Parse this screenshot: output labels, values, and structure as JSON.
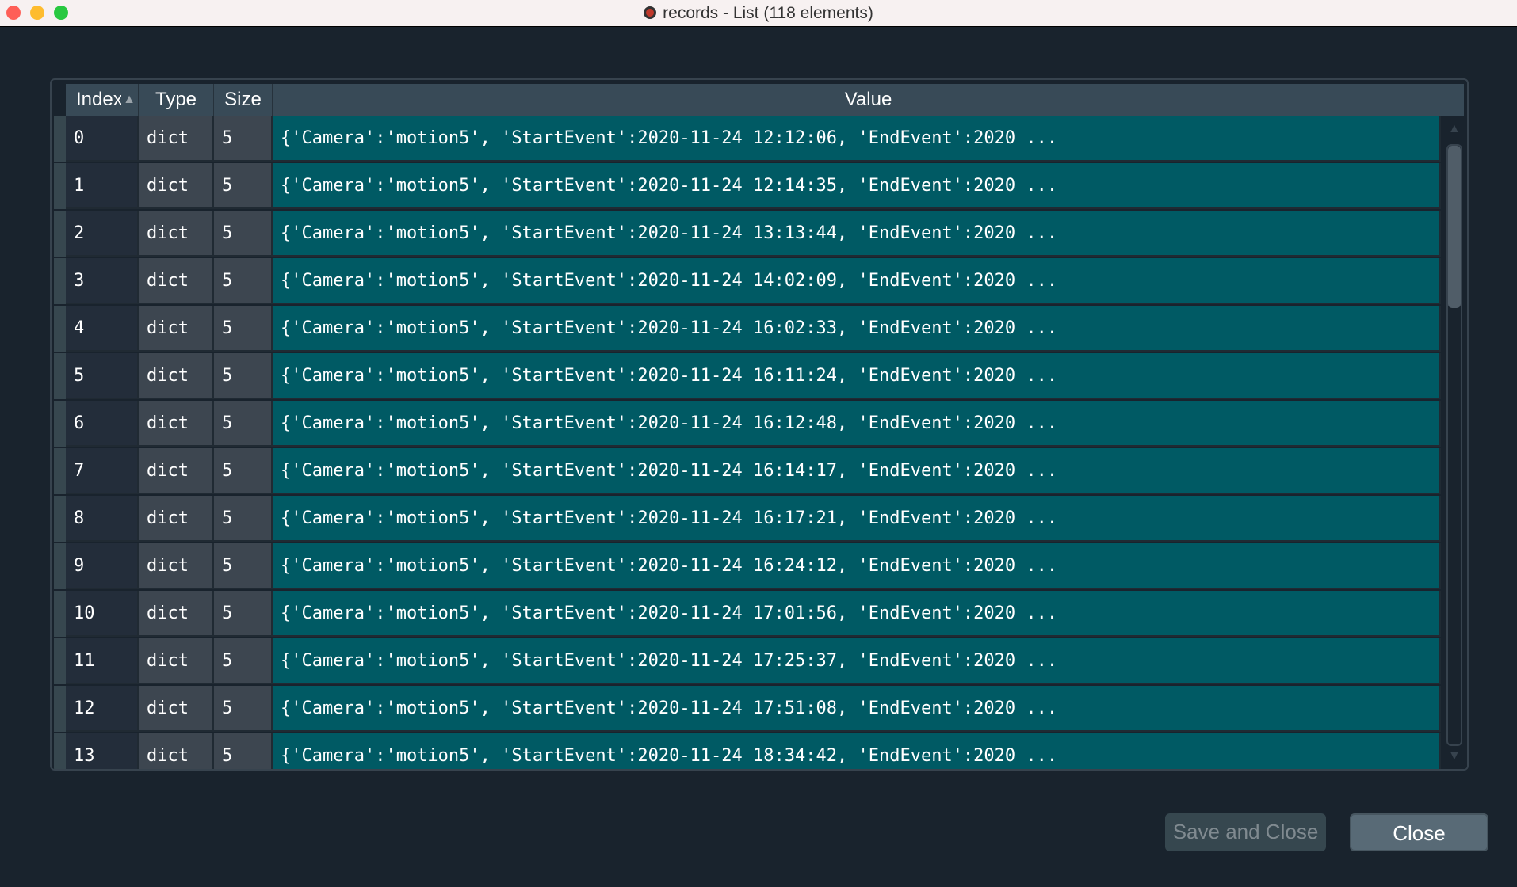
{
  "window": {
    "title": "records - List (118 elements)"
  },
  "table": {
    "columns": [
      "Index",
      "Type",
      "Size",
      "Value"
    ],
    "rows": [
      {
        "index": "0",
        "type": "dict",
        "size": "5",
        "value": "{'Camera':'motion5', 'StartEvent':2020-11-24 12:12:06, 'EndEvent':2020 ..."
      },
      {
        "index": "1",
        "type": "dict",
        "size": "5",
        "value": "{'Camera':'motion5', 'StartEvent':2020-11-24 12:14:35, 'EndEvent':2020 ..."
      },
      {
        "index": "2",
        "type": "dict",
        "size": "5",
        "value": "{'Camera':'motion5', 'StartEvent':2020-11-24 13:13:44, 'EndEvent':2020 ..."
      },
      {
        "index": "3",
        "type": "dict",
        "size": "5",
        "value": "{'Camera':'motion5', 'StartEvent':2020-11-24 14:02:09, 'EndEvent':2020 ..."
      },
      {
        "index": "4",
        "type": "dict",
        "size": "5",
        "value": "{'Camera':'motion5', 'StartEvent':2020-11-24 16:02:33, 'EndEvent':2020 ..."
      },
      {
        "index": "5",
        "type": "dict",
        "size": "5",
        "value": "{'Camera':'motion5', 'StartEvent':2020-11-24 16:11:24, 'EndEvent':2020 ..."
      },
      {
        "index": "6",
        "type": "dict",
        "size": "5",
        "value": "{'Camera':'motion5', 'StartEvent':2020-11-24 16:12:48, 'EndEvent':2020 ..."
      },
      {
        "index": "7",
        "type": "dict",
        "size": "5",
        "value": "{'Camera':'motion5', 'StartEvent':2020-11-24 16:14:17, 'EndEvent':2020 ..."
      },
      {
        "index": "8",
        "type": "dict",
        "size": "5",
        "value": "{'Camera':'motion5', 'StartEvent':2020-11-24 16:17:21, 'EndEvent':2020 ..."
      },
      {
        "index": "9",
        "type": "dict",
        "size": "5",
        "value": "{'Camera':'motion5', 'StartEvent':2020-11-24 16:24:12, 'EndEvent':2020 ..."
      },
      {
        "index": "10",
        "type": "dict",
        "size": "5",
        "value": "{'Camera':'motion5', 'StartEvent':2020-11-24 17:01:56, 'EndEvent':2020 ..."
      },
      {
        "index": "11",
        "type": "dict",
        "size": "5",
        "value": "{'Camera':'motion5', 'StartEvent':2020-11-24 17:25:37, 'EndEvent':2020 ..."
      },
      {
        "index": "12",
        "type": "dict",
        "size": "5",
        "value": "{'Camera':'motion5', 'StartEvent':2020-11-24 17:51:08, 'EndEvent':2020 ..."
      },
      {
        "index": "13",
        "type": "dict",
        "size": "5",
        "value": "{'Camera':'motion5', 'StartEvent':2020-11-24 18:34:42, 'EndEvent':2020 ..."
      }
    ]
  },
  "buttons": {
    "save_and_close": "Save and Close",
    "close": "Close"
  },
  "colors": {
    "value_cell": "#005a64",
    "background": "#19232d",
    "header": "#384a57"
  }
}
